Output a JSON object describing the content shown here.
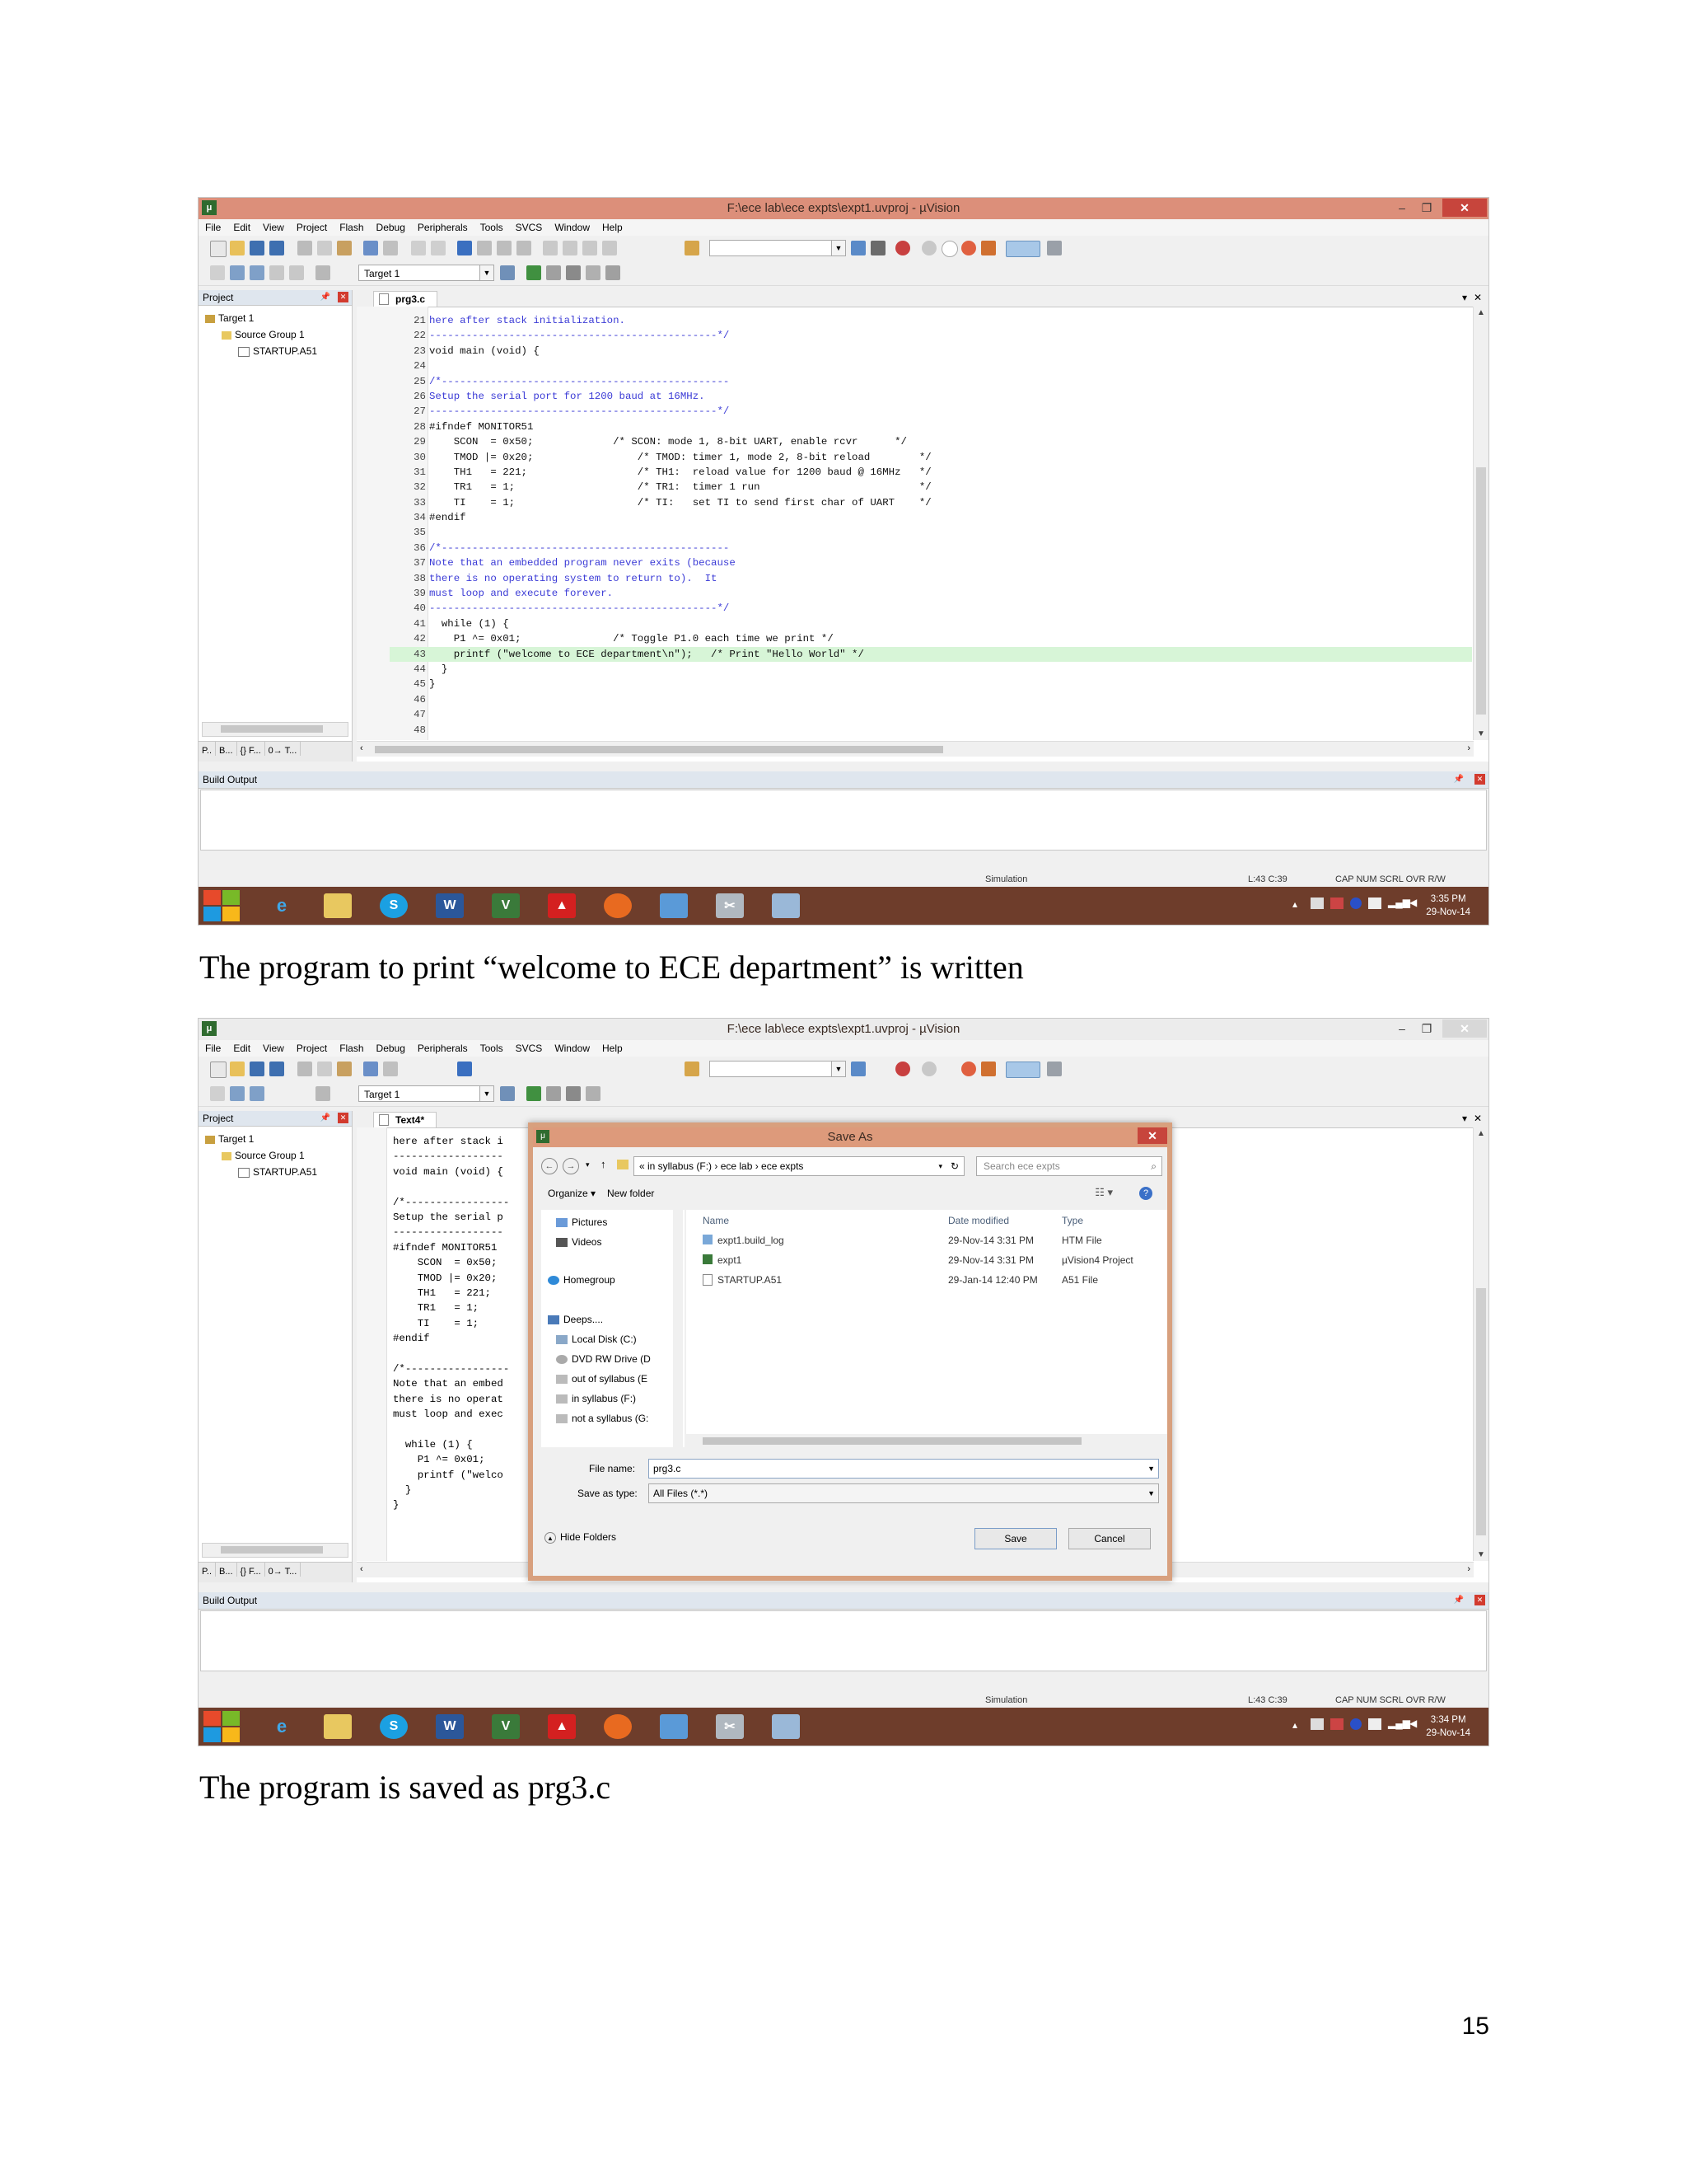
{
  "window": {
    "title": "F:\\ece lab\\ece expts\\expt1.uvproj - µVision",
    "menu": [
      "File",
      "Edit",
      "View",
      "Project",
      "Flash",
      "Debug",
      "Peripherals",
      "Tools",
      "SVCS",
      "Window",
      "Help"
    ],
    "target_select": "Target 1"
  },
  "project_pane": {
    "title": "Project",
    "tree": [
      "Target 1",
      "Source Group 1",
      "STARTUP.A51"
    ],
    "tabs": [
      "P..",
      "B...",
      "{} F...",
      "0→ T..."
    ]
  },
  "shot1": {
    "editor_tab": "prg3.c",
    "code_lines": [
      {
        "n": "21",
        "t": "here after stack initialization.",
        "c": true
      },
      {
        "n": "22",
        "t": "-----------------------------------------------*/",
        "c": true
      },
      {
        "n": "23",
        "t": "void main (void) {",
        "c": false
      },
      {
        "n": "24",
        "t": "",
        "c": false
      },
      {
        "n": "25",
        "t": "/*-----------------------------------------------",
        "c": true
      },
      {
        "n": "26",
        "t": "Setup the serial port for 1200 baud at 16MHz.",
        "c": true
      },
      {
        "n": "27",
        "t": "-----------------------------------------------*/",
        "c": true
      },
      {
        "n": "28",
        "t": "#ifndef MONITOR51",
        "c": false
      },
      {
        "n": "29",
        "t": "    SCON  = 0x50;             /* SCON: mode 1, 8-bit UART, enable rcvr      */",
        "c": false
      },
      {
        "n": "30",
        "t": "    TMOD |= 0x20;                 /* TMOD: timer 1, mode 2, 8-bit reload        */",
        "c": false
      },
      {
        "n": "31",
        "t": "    TH1   = 221;                  /* TH1:  reload value for 1200 baud @ 16MHz   */",
        "c": false
      },
      {
        "n": "32",
        "t": "    TR1   = 1;                    /* TR1:  timer 1 run                          */",
        "c": false
      },
      {
        "n": "33",
        "t": "    TI    = 1;                    /* TI:   set TI to send first char of UART    */",
        "c": false
      },
      {
        "n": "34",
        "t": "#endif",
        "c": false
      },
      {
        "n": "35",
        "t": "",
        "c": false
      },
      {
        "n": "36",
        "t": "/*-----------------------------------------------",
        "c": true
      },
      {
        "n": "37",
        "t": "Note that an embedded program never exits (because",
        "c": true
      },
      {
        "n": "38",
        "t": "there is no operating system to return to).  It",
        "c": true
      },
      {
        "n": "39",
        "t": "must loop and execute forever.",
        "c": true
      },
      {
        "n": "40",
        "t": "-----------------------------------------------*/",
        "c": true
      },
      {
        "n": "41",
        "t": "  while (1) {",
        "c": false
      },
      {
        "n": "42",
        "t": "    P1 ^= 0x01;               /* Toggle P1.0 each time we print */",
        "c": false
      },
      {
        "n": "43",
        "t": "    printf (\"welcome to ECE department\\n\");   /* Print \"Hello World\" */",
        "c": false,
        "hl": true
      },
      {
        "n": "44",
        "t": "  }",
        "c": false
      },
      {
        "n": "45",
        "t": "}",
        "c": false
      },
      {
        "n": "46",
        "t": "",
        "c": false
      },
      {
        "n": "47",
        "t": "",
        "c": false
      },
      {
        "n": "48",
        "t": "",
        "c": false
      }
    ],
    "clock_time": "3:35 PM",
    "clock_date": "29-Nov-14"
  },
  "build_output": {
    "title": "Build Output"
  },
  "statusbar": {
    "mode": "Simulation",
    "pos": "L:43 C:39",
    "keys": "CAP  NUM  SCRL  OVR  R/W"
  },
  "caption1": "The program to print “welcome to ECE department” is written",
  "shot2": {
    "editor_tab": "Text4*",
    "code_lines": [
      "here after stack i",
      "------------------",
      "void main (void) {",
      "",
      "/*-----------------",
      "Setup the serial p",
      "------------------",
      "#ifndef MONITOR51",
      "    SCON  = 0x50;",
      "    TMOD |= 0x20;",
      "    TH1   = 221;",
      "    TR1   = 1;",
      "    TI    = 1;",
      "#endif",
      "",
      "/*-----------------",
      "Note that an embed",
      "there is no operat",
      "must loop and exec",
      "",
      "  while (1) {",
      "    P1 ^= 0x01;",
      "    printf (\"welco",
      "  }",
      "}"
    ],
    "clock_time": "3:34 PM",
    "clock_date": "29-Nov-14"
  },
  "save_dialog": {
    "title": "Save As",
    "address": "«  in syllabus (F:)  ›  ece lab  ›  ece expts",
    "search_placeholder": "Search ece expts",
    "organize": "Organize ▾",
    "new_folder": "New folder",
    "nav_items": [
      "Pictures",
      "Videos",
      "Homegroup",
      "Deeps....",
      "Local Disk (C:)",
      "DVD RW Drive (D",
      "out of syllabus (E",
      "in syllabus (F:)",
      "not a syllabus (G:"
    ],
    "columns": [
      "Name",
      "Date modified",
      "Type"
    ],
    "files": [
      {
        "name": "expt1.build_log",
        "date": "29-Nov-14 3:31 PM",
        "type": "HTM File"
      },
      {
        "name": "expt1",
        "date": "29-Nov-14 3:31 PM",
        "type": "µVision4 Project"
      },
      {
        "name": "STARTUP.A51",
        "date": "29-Jan-14 12:40 PM",
        "type": "A51 File"
      }
    ],
    "file_name_label": "File name:",
    "file_name_value": "prg3.c",
    "save_type_label": "Save as type:",
    "save_type_value": "All Files (*.*)",
    "hide_folders": "Hide Folders",
    "save_button": "Save",
    "cancel_button": "Cancel"
  },
  "caption2": "The program is saved as prg3.c",
  "page_number": "15",
  "colors": {
    "titlebar": "#dc8f7a",
    "taskbar": "#6e3d2b",
    "code_comment": "#3b3bd6",
    "highlight_line": "#d7f5d7"
  }
}
